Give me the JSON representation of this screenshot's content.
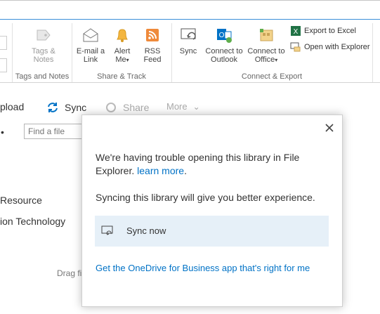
{
  "ribbon": {
    "tags_notes": {
      "button": "Tags &\nNotes",
      "group": "Tags and Notes"
    },
    "share_track": {
      "group": "Share & Track",
      "email": "E-mail a\nLink",
      "alert": "Alert\nMe",
      "rss": "RSS\nFeed"
    },
    "connect_export": {
      "group": "Connect & Export",
      "sync": "Sync",
      "outlook": "Connect to\nOutlook",
      "office": "Connect to\nOffice",
      "export_excel": "Export to Excel",
      "open_explorer": "Open with Explorer"
    }
  },
  "command_bar": {
    "upload": "pload",
    "sync": "Sync",
    "share": "Share",
    "more": "More"
  },
  "search": {
    "placeholder": "Find a file"
  },
  "list": {
    "items": [
      "Resource",
      "ion Technology"
    ],
    "drag_text": "Drag fi"
  },
  "dialog": {
    "message_line": "We're having trouble opening this library in File Explorer.",
    "learn_more": "learn more",
    "message_end": ".",
    "sync_message": "Syncing this library will give you better experience.",
    "sync_now": "Sync now",
    "get_app_link": "Get the OneDrive for Business app that's right for me"
  },
  "colors": {
    "accent": "#0072c6",
    "highlight": "#e6f0f8"
  }
}
